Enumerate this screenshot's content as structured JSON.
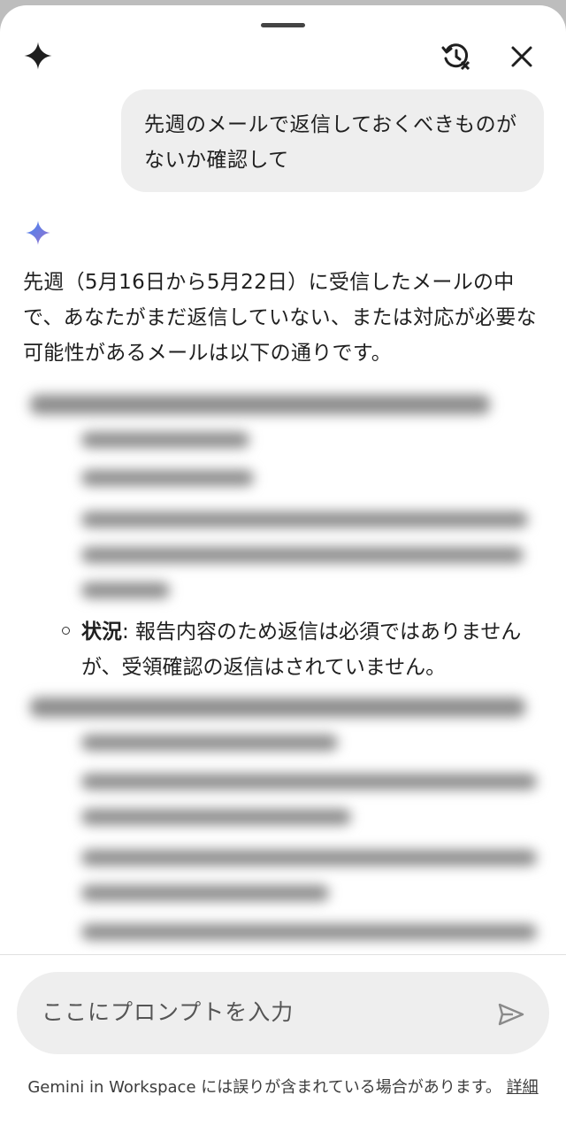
{
  "header": {
    "history_icon": "history-off-icon",
    "close_icon": "close-icon"
  },
  "conversation": {
    "user_message": "先週のメールで返信しておくべきものがないか確認して",
    "response_intro": "先週（5月16日から5月22日）に受信したメールの中で、あなたがまだ返信していない、または対応が必要な可能性があるメールは以下の通りです。",
    "status_label": "状況",
    "status_text": ": 報告内容のため返信は必須ではありませんが、受領確認の返信はされていません。"
  },
  "composer": {
    "placeholder": "ここにプロンプトを入力",
    "send_icon": "send-icon"
  },
  "footer": {
    "disclaimer": "Gemini in Workspace には誤りが含まれている場合があります。",
    "details_link": "詳細"
  },
  "colors": {
    "sheet": "#ffffff",
    "bubble": "#eeeeee",
    "gemini_blue": "#4285f4",
    "gemini_purple": "#9b72cb"
  }
}
